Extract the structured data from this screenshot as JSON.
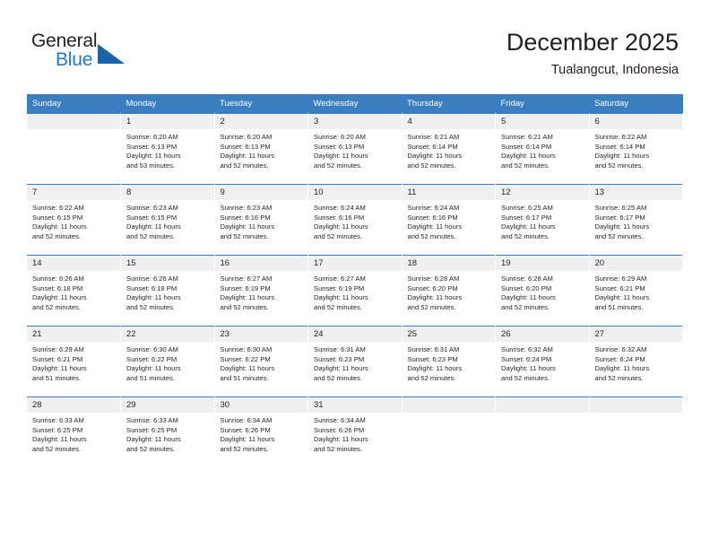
{
  "logo": {
    "word_one": "General",
    "word_two": "Blue",
    "triangle_color": "#1565a8",
    "blue_color": "#1c7bc4"
  },
  "header": {
    "title": "December 2025",
    "subtitle": "Tualangcut, Indonesia",
    "accent_color": "#3b7ebf",
    "daynum_band_color": "#f0f0f0"
  },
  "weekdays": [
    "Sunday",
    "Monday",
    "Tuesday",
    "Wednesday",
    "Thursday",
    "Friday",
    "Saturday"
  ],
  "labels": {
    "sunrise_prefix": "Sunrise:",
    "sunset_prefix": "Sunset:",
    "daylight_prefix": "Daylight:"
  },
  "weeks": [
    [
      {
        "day": "",
        "sunrise": "",
        "sunset": "",
        "daylight_line1": "",
        "daylight_line2": ""
      },
      {
        "day": "1",
        "sunrise": "Sunrise: 6:20 AM",
        "sunset": "Sunset: 6:13 PM",
        "daylight_line1": "Daylight: 11 hours",
        "daylight_line2": "and 53 minutes."
      },
      {
        "day": "2",
        "sunrise": "Sunrise: 6:20 AM",
        "sunset": "Sunset: 6:13 PM",
        "daylight_line1": "Daylight: 11 hours",
        "daylight_line2": "and 52 minutes."
      },
      {
        "day": "3",
        "sunrise": "Sunrise: 6:20 AM",
        "sunset": "Sunset: 6:13 PM",
        "daylight_line1": "Daylight: 11 hours",
        "daylight_line2": "and 52 minutes."
      },
      {
        "day": "4",
        "sunrise": "Sunrise: 6:21 AM",
        "sunset": "Sunset: 6:14 PM",
        "daylight_line1": "Daylight: 11 hours",
        "daylight_line2": "and 52 minutes."
      },
      {
        "day": "5",
        "sunrise": "Sunrise: 6:21 AM",
        "sunset": "Sunset: 6:14 PM",
        "daylight_line1": "Daylight: 11 hours",
        "daylight_line2": "and 52 minutes."
      },
      {
        "day": "6",
        "sunrise": "Sunrise: 6:22 AM",
        "sunset": "Sunset: 6:14 PM",
        "daylight_line1": "Daylight: 11 hours",
        "daylight_line2": "and 52 minutes."
      }
    ],
    [
      {
        "day": "7",
        "sunrise": "Sunrise: 6:22 AM",
        "sunset": "Sunset: 6:15 PM",
        "daylight_line1": "Daylight: 11 hours",
        "daylight_line2": "and 52 minutes."
      },
      {
        "day": "8",
        "sunrise": "Sunrise: 6:23 AM",
        "sunset": "Sunset: 6:15 PM",
        "daylight_line1": "Daylight: 11 hours",
        "daylight_line2": "and 52 minutes."
      },
      {
        "day": "9",
        "sunrise": "Sunrise: 6:23 AM",
        "sunset": "Sunset: 6:16 PM",
        "daylight_line1": "Daylight: 11 hours",
        "daylight_line2": "and 52 minutes."
      },
      {
        "day": "10",
        "sunrise": "Sunrise: 6:24 AM",
        "sunset": "Sunset: 6:16 PM",
        "daylight_line1": "Daylight: 11 hours",
        "daylight_line2": "and 52 minutes."
      },
      {
        "day": "11",
        "sunrise": "Sunrise: 6:24 AM",
        "sunset": "Sunset: 6:16 PM",
        "daylight_line1": "Daylight: 11 hours",
        "daylight_line2": "and 52 minutes."
      },
      {
        "day": "12",
        "sunrise": "Sunrise: 6:25 AM",
        "sunset": "Sunset: 6:17 PM",
        "daylight_line1": "Daylight: 11 hours",
        "daylight_line2": "and 52 minutes."
      },
      {
        "day": "13",
        "sunrise": "Sunrise: 6:25 AM",
        "sunset": "Sunset: 6:17 PM",
        "daylight_line1": "Daylight: 11 hours",
        "daylight_line2": "and 52 minutes."
      }
    ],
    [
      {
        "day": "14",
        "sunrise": "Sunrise: 6:26 AM",
        "sunset": "Sunset: 6:18 PM",
        "daylight_line1": "Daylight: 11 hours",
        "daylight_line2": "and 52 minutes."
      },
      {
        "day": "15",
        "sunrise": "Sunrise: 6:26 AM",
        "sunset": "Sunset: 6:18 PM",
        "daylight_line1": "Daylight: 11 hours",
        "daylight_line2": "and 52 minutes."
      },
      {
        "day": "16",
        "sunrise": "Sunrise: 6:27 AM",
        "sunset": "Sunset: 6:19 PM",
        "daylight_line1": "Daylight: 11 hours",
        "daylight_line2": "and 52 minutes."
      },
      {
        "day": "17",
        "sunrise": "Sunrise: 6:27 AM",
        "sunset": "Sunset: 6:19 PM",
        "daylight_line1": "Daylight: 11 hours",
        "daylight_line2": "and 52 minutes."
      },
      {
        "day": "18",
        "sunrise": "Sunrise: 6:28 AM",
        "sunset": "Sunset: 6:20 PM",
        "daylight_line1": "Daylight: 11 hours",
        "daylight_line2": "and 52 minutes."
      },
      {
        "day": "19",
        "sunrise": "Sunrise: 6:28 AM",
        "sunset": "Sunset: 6:20 PM",
        "daylight_line1": "Daylight: 11 hours",
        "daylight_line2": "and 52 minutes."
      },
      {
        "day": "20",
        "sunrise": "Sunrise: 6:29 AM",
        "sunset": "Sunset: 6:21 PM",
        "daylight_line1": "Daylight: 11 hours",
        "daylight_line2": "and 51 minutes."
      }
    ],
    [
      {
        "day": "21",
        "sunrise": "Sunrise: 6:29 AM",
        "sunset": "Sunset: 6:21 PM",
        "daylight_line1": "Daylight: 11 hours",
        "daylight_line2": "and 51 minutes."
      },
      {
        "day": "22",
        "sunrise": "Sunrise: 6:30 AM",
        "sunset": "Sunset: 6:22 PM",
        "daylight_line1": "Daylight: 11 hours",
        "daylight_line2": "and 51 minutes."
      },
      {
        "day": "23",
        "sunrise": "Sunrise: 6:30 AM",
        "sunset": "Sunset: 6:22 PM",
        "daylight_line1": "Daylight: 11 hours",
        "daylight_line2": "and 51 minutes."
      },
      {
        "day": "24",
        "sunrise": "Sunrise: 6:31 AM",
        "sunset": "Sunset: 6:23 PM",
        "daylight_line1": "Daylight: 11 hours",
        "daylight_line2": "and 52 minutes."
      },
      {
        "day": "25",
        "sunrise": "Sunrise: 6:31 AM",
        "sunset": "Sunset: 6:23 PM",
        "daylight_line1": "Daylight: 11 hours",
        "daylight_line2": "and 52 minutes."
      },
      {
        "day": "26",
        "sunrise": "Sunrise: 6:32 AM",
        "sunset": "Sunset: 6:24 PM",
        "daylight_line1": "Daylight: 11 hours",
        "daylight_line2": "and 52 minutes."
      },
      {
        "day": "27",
        "sunrise": "Sunrise: 6:32 AM",
        "sunset": "Sunset: 6:24 PM",
        "daylight_line1": "Daylight: 11 hours",
        "daylight_line2": "and 52 minutes."
      }
    ],
    [
      {
        "day": "28",
        "sunrise": "Sunrise: 6:33 AM",
        "sunset": "Sunset: 6:25 PM",
        "daylight_line1": "Daylight: 11 hours",
        "daylight_line2": "and 52 minutes."
      },
      {
        "day": "29",
        "sunrise": "Sunrise: 6:33 AM",
        "sunset": "Sunset: 6:25 PM",
        "daylight_line1": "Daylight: 11 hours",
        "daylight_line2": "and 52 minutes."
      },
      {
        "day": "30",
        "sunrise": "Sunrise: 6:34 AM",
        "sunset": "Sunset: 6:26 PM",
        "daylight_line1": "Daylight: 11 hours",
        "daylight_line2": "and 52 minutes."
      },
      {
        "day": "31",
        "sunrise": "Sunrise: 6:34 AM",
        "sunset": "Sunset: 6:26 PM",
        "daylight_line1": "Daylight: 11 hours",
        "daylight_line2": "and 52 minutes."
      },
      {
        "day": "",
        "sunrise": "",
        "sunset": "",
        "daylight_line1": "",
        "daylight_line2": ""
      },
      {
        "day": "",
        "sunrise": "",
        "sunset": "",
        "daylight_line1": "",
        "daylight_line2": ""
      },
      {
        "day": "",
        "sunrise": "",
        "sunset": "",
        "daylight_line1": "",
        "daylight_line2": ""
      }
    ]
  ]
}
